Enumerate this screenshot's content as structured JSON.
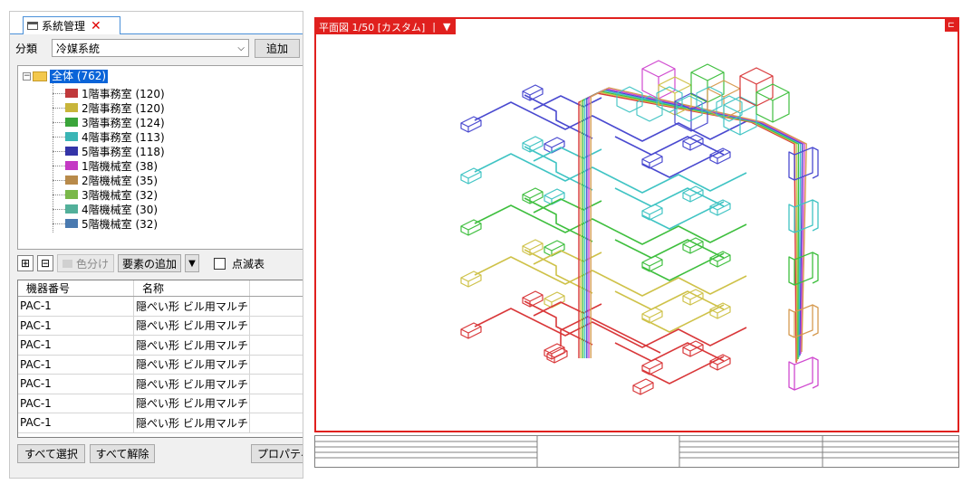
{
  "panel": {
    "tab_title": "系統管理",
    "category_label": "分類",
    "category_value": "冷媒系統",
    "add_button": "追加"
  },
  "tree": {
    "root_label": "全体 (762)",
    "items": [
      {
        "label": "1階事務室 (120)",
        "color": "#c0393b"
      },
      {
        "label": "2階事務室 (120)",
        "color": "#c8b53a"
      },
      {
        "label": "3階事務室 (124)",
        "color": "#3aa53a"
      },
      {
        "label": "4階事務室 (113)",
        "color": "#3ab5b5"
      },
      {
        "label": "5階事務室 (118)",
        "color": "#3434a8"
      },
      {
        "label": "1階機械室 (38)",
        "color": "#c43ac4"
      },
      {
        "label": "2階機械室 (35)",
        "color": "#b88a4a"
      },
      {
        "label": "3階機械室 (32)",
        "color": "#7ab84a"
      },
      {
        "label": "4階機械室 (30)",
        "color": "#52b09a"
      },
      {
        "label": "5階機械室 (32)",
        "color": "#4a7ab0"
      }
    ]
  },
  "toolbar2": {
    "color_button": "色分け",
    "add_element_button": "要素の追加",
    "blink_label": "点滅表"
  },
  "table": {
    "headers": [
      "機器番号",
      "名称"
    ],
    "rows": [
      [
        "PAC-1",
        "隠ぺい形 ビル用マルチ..."
      ],
      [
        "PAC-1",
        "隠ぺい形 ビル用マルチ..."
      ],
      [
        "PAC-1",
        "隠ぺい形 ビル用マルチ..."
      ],
      [
        "PAC-1",
        "隠ぺい形 ビル用マルチ..."
      ],
      [
        "PAC-1",
        "隠ぺい形 ビル用マルチ..."
      ],
      [
        "PAC-1",
        "隠ぺい形 ビル用マルチ..."
      ],
      [
        "PAC-1",
        "隠ぺい形 ビル用マルチ..."
      ]
    ]
  },
  "bottom": {
    "select_all": "すべて選択",
    "deselect_all": "すべて解除",
    "properties": "プロパティ表"
  },
  "view": {
    "tag_label": "平面図 1/50 [カスタム]",
    "accent": "#e0201e"
  },
  "floor_colors": {
    "f1": "#d9383a",
    "f2": "#cfc24a",
    "f3": "#3fbf3f",
    "f4": "#40c4c4",
    "f5": "#4a4ad0",
    "m1": "#d04ad0",
    "m2": "#d69a50"
  }
}
